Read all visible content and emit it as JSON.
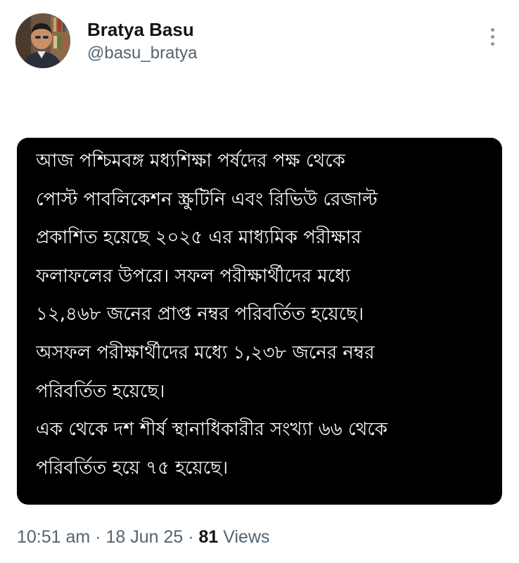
{
  "author": {
    "display_name": "Bratya Basu",
    "handle": "@basu_bratya"
  },
  "more_icon": "more-vertical-icon",
  "image_text": {
    "lines": [
      "আজ পশ্চিমবঙ্গ মধ্যশিক্ষা পর্ষদের পক্ষ থেকে",
      "পোস্ট পাবলিকেশন স্ক্রুটিনি এবং রিভিউ রেজাল্ট",
      "প্রকাশিত হয়েছে ২০২৫ এর মাধ্যমিক পরীক্ষার",
      "ফলাফলের উপরে। সফল পরীক্ষার্থীদের মধ্যে",
      "১২,৪৬৮ জনের প্রাপ্ত নম্বর পরিবর্তিত হয়েছে।",
      "অসফল পরীক্ষার্থীদের মধ্যে ১,২৩৮ জনের নম্বর",
      "পরিবর্তিত হয়েছে।",
      "এক থেকে দশ শীর্ষ স্থানাধিকারীর সংখ্যা ৬৬ থেকে",
      "পরিবর্তিত হয়ে ৭৫ হয়েছে।"
    ]
  },
  "meta": {
    "time": "10:51 am",
    "separator": " · ",
    "date": "18 Jun 25",
    "views_count": "81",
    "views_label": "Views"
  },
  "colors": {
    "card_background": "#000000",
    "card_text": "#ffffff",
    "secondary_text": "#536471",
    "primary_text": "#0f1419"
  }
}
